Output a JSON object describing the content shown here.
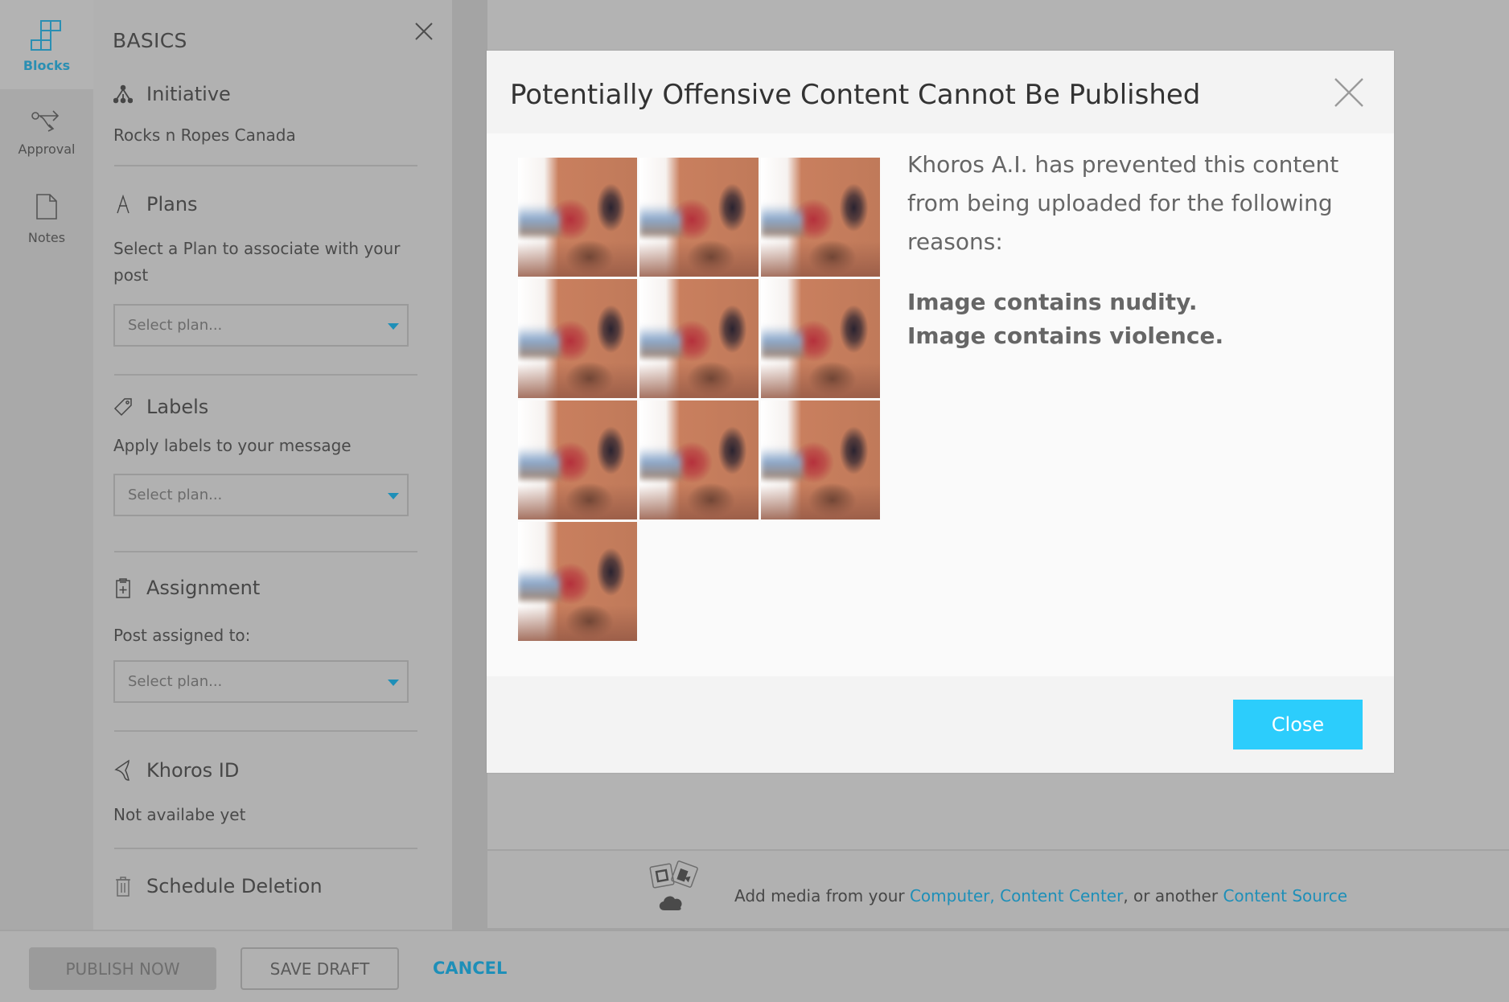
{
  "nav": {
    "items": [
      {
        "label": "Blocks",
        "icon": "blocks-icon",
        "active": true
      },
      {
        "label": "Approval",
        "icon": "approval-flow-icon",
        "active": false
      },
      {
        "label": "Notes",
        "icon": "notes-icon",
        "active": false
      }
    ]
  },
  "panel": {
    "title": "BASICS",
    "sections": {
      "initiative": {
        "title": "Initiative",
        "icon": "hierarchy-icon",
        "value": "Rocks n Ropes Canada"
      },
      "plans": {
        "title": "Plans",
        "icon": "plans-icon",
        "description": "Select a Plan to associate with your post",
        "select_placeholder": "Select plan..."
      },
      "labels": {
        "title": "Labels",
        "icon": "tag-icon",
        "description": "Apply labels to your message",
        "select_placeholder": "Select plan..."
      },
      "assignment": {
        "title": "Assignment",
        "icon": "clipboard-plus-icon",
        "description": "Post assigned to:",
        "select_placeholder": "Select plan..."
      },
      "khoros_id": {
        "title": "Khoros ID",
        "icon": "khoros-logo-icon",
        "value": "Not availabe yet"
      },
      "schedule_deletion": {
        "title": "Schedule Deletion",
        "icon": "trash-icon"
      }
    }
  },
  "media_bar": {
    "prefix": "Add media from your ",
    "link_computer": "Computer,",
    "link_content_center": "Content Center",
    "middle": ", or another ",
    "link_content_source": "Content Source"
  },
  "actions": {
    "publish_now": "PUBLISH NOW",
    "save_draft": "SAVE DRAFT",
    "cancel": "CANCEL"
  },
  "modal": {
    "title": "Potentially Offensive Content Cannot Be Published",
    "message": "Khoros A.I. has prevented this content from being uploaded for the following reasons:",
    "reasons": [
      "Image contains nudity.",
      "Image contains violence."
    ],
    "thumbnail_count": 10,
    "close_button": "Close"
  },
  "colors": {
    "accent": "#1e8fb8",
    "close_button": "#2ccdfc",
    "overlay": "#b3b3b3"
  }
}
